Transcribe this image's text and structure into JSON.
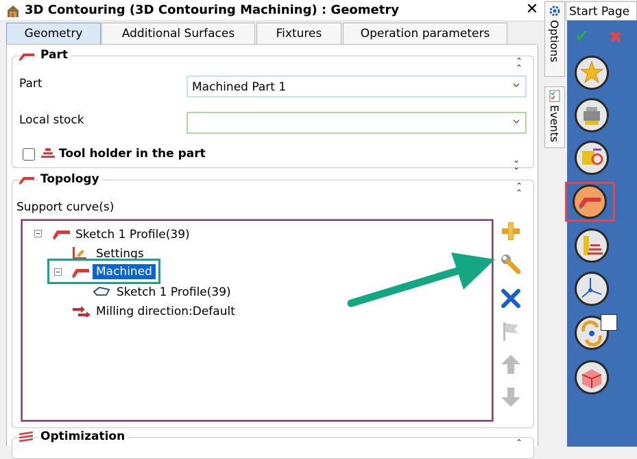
{
  "window": {
    "title": "3D Contouring (3D Contouring Machining) : Geometry",
    "close_glyph": "✕"
  },
  "tabs": [
    {
      "label": "Geometry",
      "active": true
    },
    {
      "label": "Additional Surfaces",
      "active": false
    },
    {
      "label": "Fixtures",
      "active": false
    },
    {
      "label": "Operation parameters",
      "active": false
    }
  ],
  "part_group": {
    "title": "Part",
    "part_label": "Part",
    "part_value": "Machined Part 1",
    "local_stock_label": "Local stock",
    "local_stock_value": "",
    "tool_holder_label": "Tool holder in the part",
    "tool_holder_checked": false
  },
  "topology_group": {
    "title": "Topology",
    "support_label": "Support curve(s)",
    "tree": [
      {
        "label": "Sketch 1 Profile(39)",
        "icon": "profile-3d-icon",
        "expander": "minus"
      },
      {
        "label": "Settings",
        "icon": "settings-icon"
      },
      {
        "label": "Machined",
        "icon": "machined-icon",
        "expander": "minus",
        "selected": true
      },
      {
        "label": "Sketch 1 Profile(39)",
        "icon": "curve-outline-icon"
      },
      {
        "label": "Milling direction:Default",
        "icon": "milling-direction-icon"
      }
    ]
  },
  "optimization_group": {
    "title": "Optimization"
  },
  "side_buttons": [
    "add-icon",
    "wrench-icon",
    "delete-icon",
    "flag-icon",
    "arrow-up-icon",
    "arrow-down-icon"
  ],
  "right_tabs": {
    "options": "Options",
    "events": "Events"
  },
  "start_page": {
    "tab_label": "Start Page",
    "ok_glyph": "✔",
    "cancel_glyph": "✖",
    "buttons": [
      "favorites-icon",
      "tool-icon",
      "strategy-icon",
      "geometry-icon",
      "holder-icon",
      "axis-icon",
      "link-icon",
      "stock-icon"
    ],
    "highlighted_button": "geometry-icon"
  },
  "colors": {
    "accent_green": "#15a684",
    "selection_blue": "#0a64d2",
    "highlight_red": "#e0464a"
  }
}
